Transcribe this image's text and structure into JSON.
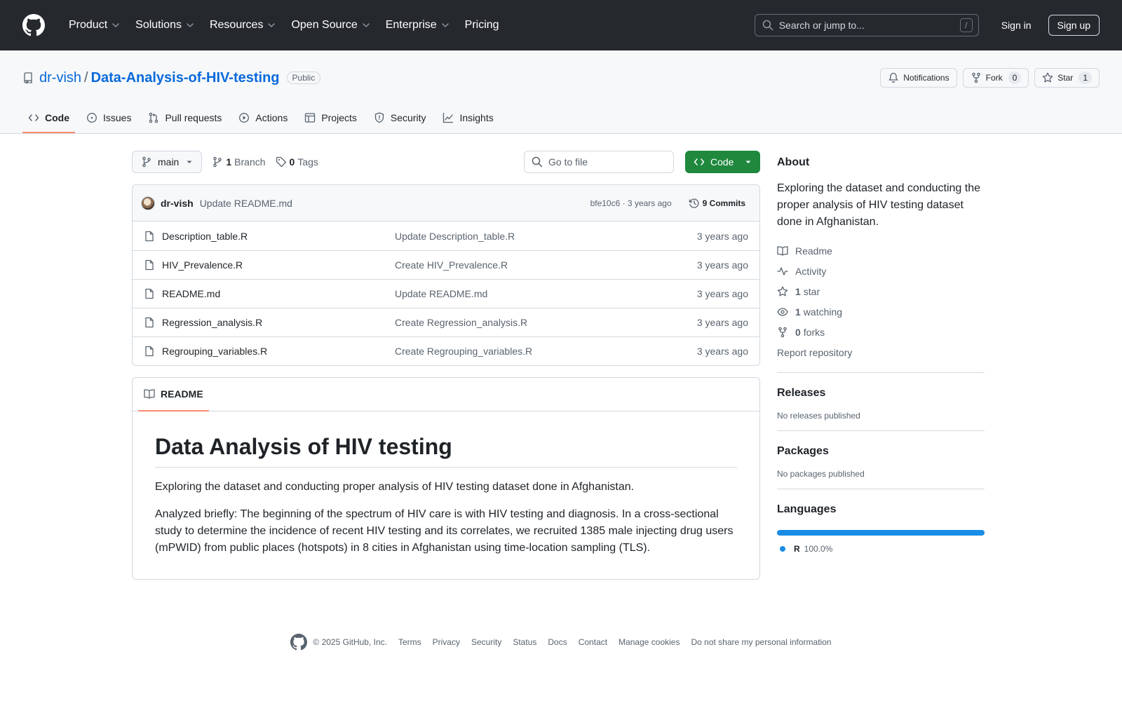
{
  "topbar": {
    "nav": [
      {
        "label": "Product",
        "chevron": true
      },
      {
        "label": "Solutions",
        "chevron": true
      },
      {
        "label": "Resources",
        "chevron": true
      },
      {
        "label": "Open Source",
        "chevron": true
      },
      {
        "label": "Enterprise",
        "chevron": true
      },
      {
        "label": "Pricing",
        "chevron": false
      }
    ],
    "search_placeholder": "Search or jump to...",
    "search_key": "/",
    "sign_in": "Sign in",
    "sign_up": "Sign up"
  },
  "repo": {
    "owner": "dr-vish",
    "separator": "/",
    "name": "Data-Analysis-of-HIV-testing",
    "visibility": "Public",
    "actions": {
      "notifications": "Notifications",
      "fork": "Fork",
      "fork_count": "0",
      "star": "Star",
      "star_count": "1"
    },
    "tabs": [
      {
        "label": "Code",
        "icon": "code-icon",
        "active": true
      },
      {
        "label": "Issues",
        "icon": "issue-icon",
        "active": false
      },
      {
        "label": "Pull requests",
        "icon": "pull-request-icon",
        "active": false
      },
      {
        "label": "Actions",
        "icon": "play-icon",
        "active": false
      },
      {
        "label": "Projects",
        "icon": "table-icon",
        "active": false
      },
      {
        "label": "Security",
        "icon": "shield-icon",
        "active": false
      },
      {
        "label": "Insights",
        "icon": "graph-icon",
        "active": false
      }
    ]
  },
  "filenav": {
    "branch": "main",
    "branch_count": "1",
    "branch_label": "Branch",
    "tag_count": "0",
    "tag_label": "Tags",
    "goto_placeholder": "Go to file",
    "code_button": "Code"
  },
  "commit": {
    "author": "dr-vish",
    "message": "Update README.md",
    "hash_time": "bfe10c6 · 3 years ago",
    "commits": "9 Commits"
  },
  "files": [
    {
      "name": "Description_table.R",
      "message": "Update Description_table.R",
      "time": "3 years ago"
    },
    {
      "name": "HIV_Prevalence.R",
      "message": "Create HIV_Prevalence.R",
      "time": "3 years ago"
    },
    {
      "name": "README.md",
      "message": "Update README.md",
      "time": "3 years ago"
    },
    {
      "name": "Regression_analysis.R",
      "message": "Create Regression_analysis.R",
      "time": "3 years ago"
    },
    {
      "name": "Regrouping_variables.R",
      "message": "Create Regrouping_variables.R",
      "time": "3 years ago"
    }
  ],
  "readme": {
    "tab_label": "README",
    "title": "Data Analysis of HIV testing",
    "paragraph1": "Exploring the dataset and conducting proper analysis of HIV testing dataset done in Afghanistan.",
    "paragraph2": "Analyzed briefly: The beginning of the spectrum of HIV care is with HIV testing and diagnosis. In a cross-sectional study to determine the incidence of recent HIV testing and its correlates, we recruited 1385 male injecting drug users (mPWID) from public places (hotspots) in 8 cities in Afghanistan using time-location sampling (TLS)."
  },
  "about": {
    "heading": "About",
    "description": "Exploring the dataset and conducting the proper analysis of HIV testing dataset done in Afghanistan.",
    "readme": "Readme",
    "activity": "Activity",
    "stars_count": "1",
    "stars_label": "star",
    "watching_count": "1",
    "watching_label": "watching",
    "forks_count": "0",
    "forks_label": "forks",
    "report": "Report repository"
  },
  "releases": {
    "heading": "Releases",
    "empty": "No releases published"
  },
  "packages": {
    "heading": "Packages",
    "empty": "No packages published"
  },
  "languages": {
    "heading": "Languages",
    "name": "R",
    "percent": "100.0%",
    "fraction": 1.0,
    "color": "#198CE7"
  },
  "footer": {
    "copyright": "© 2025 GitHub, Inc.",
    "links": [
      "Terms",
      "Privacy",
      "Security",
      "Status",
      "Docs",
      "Contact",
      "Manage cookies",
      "Do not share my personal information"
    ]
  },
  "colors": {
    "header_bg": "#25292e",
    "link": "#0969da",
    "green_button": "#1f883d",
    "active_tab_underline": "#fd8c73"
  }
}
